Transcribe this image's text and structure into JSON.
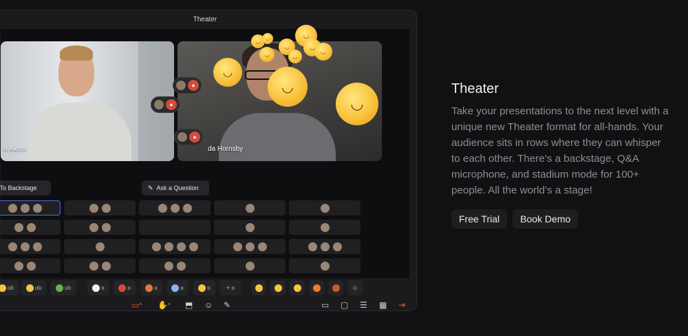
{
  "window": {
    "title": "Theater"
  },
  "videos": [
    {
      "name_partial": "n Akers"
    },
    {
      "name_partial": "da Hornsby"
    }
  ],
  "actions": {
    "backstage_label": "To Backstage",
    "question_label": "Ask a Question"
  },
  "panel": {
    "title": "Theater",
    "description": "Take your presentations to the next level with a unique new Theater format for all-hands. Your audience sits in rows where they can whisper to each other. There’s a backstage, Q&A microphone, and stadium mode for 100+ people. All the world’s a stage!",
    "cta_primary": "Free Trial",
    "cta_secondary": "Book Demo"
  },
  "colors": {
    "background": "#111113",
    "window": "#1b1b1d",
    "accent_selected": "#4b6ed9",
    "record_red": "#e0533f"
  },
  "toolbar_icons": [
    "video-icon",
    "hand-raise-icon",
    "share-screen-icon",
    "emoji-icon",
    "pen-icon",
    "folder-icon",
    "chat-icon",
    "notes-icon",
    "calendar-icon",
    "leave-icon"
  ]
}
